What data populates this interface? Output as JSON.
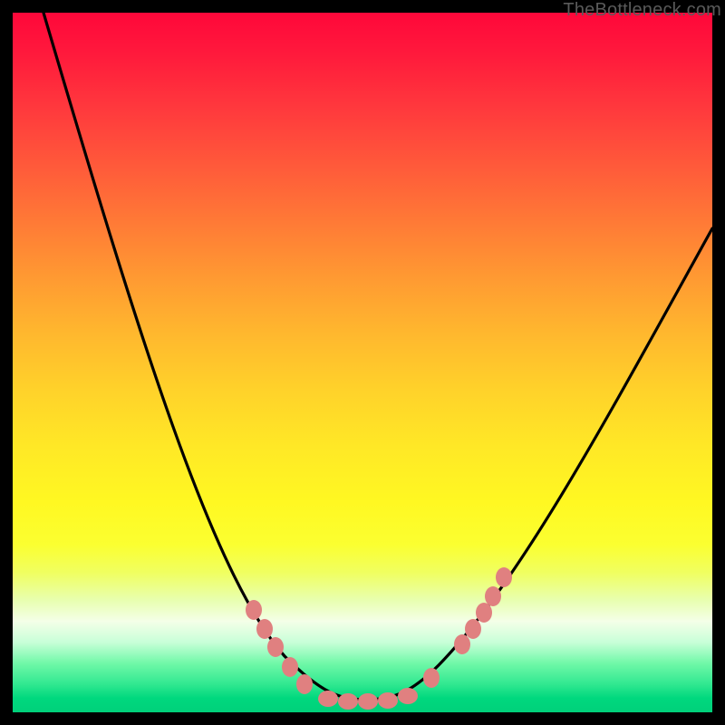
{
  "watermark": "TheBottleneck.com",
  "chart_data": {
    "type": "line",
    "title": "",
    "xlabel": "",
    "ylabel": "",
    "xlim": [
      0,
      100
    ],
    "ylim": [
      0,
      100
    ],
    "grid": false,
    "legend": false,
    "background": "vertical-gradient red→orange→yellow→green (top=high bottleneck, bottom=low)",
    "series": [
      {
        "name": "bottleneck-curve",
        "x": [
          4,
          12,
          20,
          28,
          35,
          40,
          45,
          50,
          55,
          60,
          68,
          78,
          90,
          100
        ],
        "y": [
          100,
          72,
          50,
          32,
          18,
          10,
          4,
          2,
          4,
          8,
          18,
          36,
          56,
          70
        ]
      }
    ],
    "highlighted_points": {
      "name": "marked-range",
      "color": "#e08080",
      "x": [
        34,
        36,
        38,
        40,
        42,
        45,
        48,
        51,
        54,
        57,
        60,
        64,
        66,
        67,
        69,
        70
      ],
      "y": [
        15,
        12,
        10,
        7,
        5,
        3,
        2,
        2,
        2,
        3,
        5,
        9,
        11,
        13,
        16,
        19
      ]
    }
  }
}
